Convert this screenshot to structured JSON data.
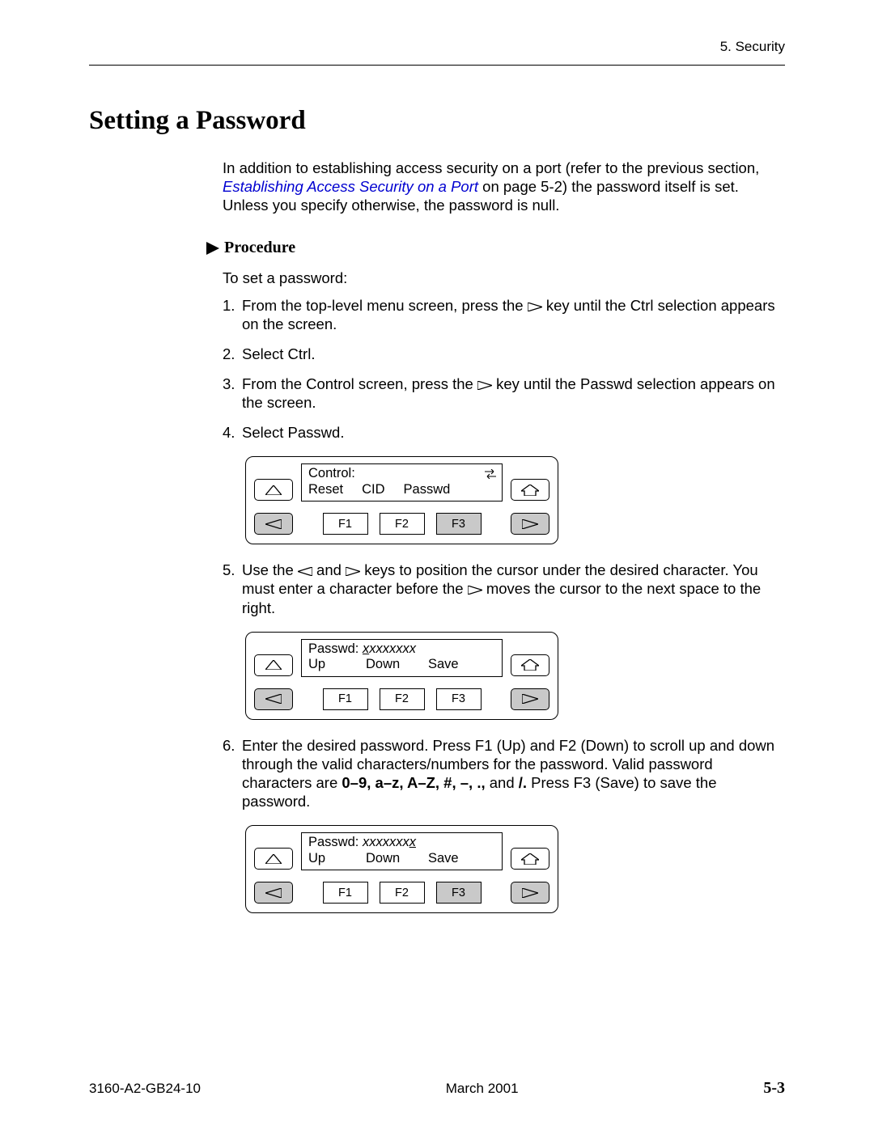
{
  "header": {
    "section": "5. Security"
  },
  "title": "Setting a Password",
  "intro": {
    "pre": "In addition to establishing access security on a port (refer to the previous section, ",
    "link": "Establishing Access Security on a Port",
    "post": " on page 5-2) the password itself is set. Unless you specify otherwise, the password is null."
  },
  "procedure_label": "Procedure",
  "lead_in": "To set a password:",
  "steps": {
    "s1a": "From the top-level menu screen, press the ",
    "s1b": " key until the Ctrl selection appears on the screen.",
    "s2": "Select Ctrl.",
    "s3a": "From the Control screen, press the ",
    "s3b": " key until the Passwd selection appears on the screen.",
    "s4": "Select Passwd.",
    "s5a": "Use the ",
    "s5b": " and ",
    "s5c": " keys to position the cursor under the desired character. You must enter a character before the ",
    "s5d": " moves the cursor to the next space to the right.",
    "s6a": "Enter the desired password. Press F1 (Up) and F2 (Down) to scroll up and down through the valid characters/numbers for the password. Valid password characters are ",
    "s6bold": "0–9, a–z, A–Z, #, –, .,",
    "s6b": " and ",
    "s6bold2": "/.",
    "s6c": " Press F3 (Save) to save the password."
  },
  "panel1": {
    "line1": "Control:",
    "menu": [
      "Reset",
      "CID",
      "Passwd"
    ],
    "fkeys": [
      "F1",
      "F2",
      "F3"
    ],
    "highlighted_fkey": 2
  },
  "panel2": {
    "pw_label": "Passwd: ",
    "pw_value_head": "x",
    "pw_value_tail": "xxxxxxx",
    "menu": [
      "Up",
      "Down",
      "Save"
    ],
    "fkeys": [
      "F1",
      "F2",
      "F3"
    ],
    "highlighted_fkey": -1
  },
  "panel3": {
    "pw_label": "Passwd: ",
    "pw_value_head": "xxxxxxx",
    "pw_value_tail": "x",
    "menu": [
      "Up",
      "Down",
      "Save"
    ],
    "fkeys": [
      "F1",
      "F2",
      "F3"
    ],
    "highlighted_fkey": 2
  },
  "footer": {
    "doc_id": "3160-A2-GB24-10",
    "date": "March 2001",
    "page": "5-3"
  }
}
